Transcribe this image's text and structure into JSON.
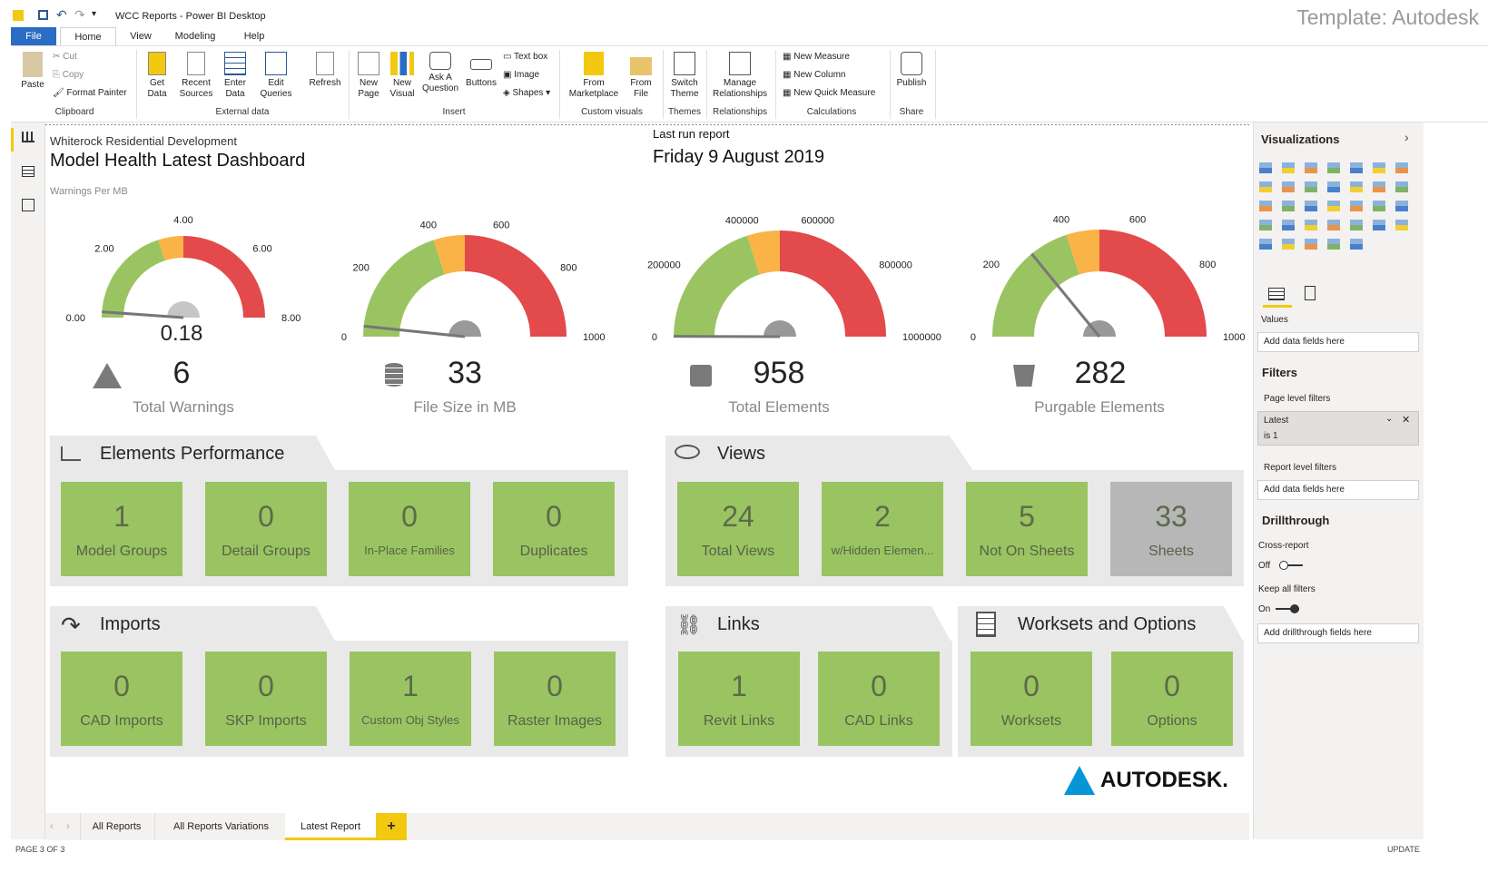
{
  "window": {
    "title": "WCC Reports - Power BI Desktop",
    "template_label": "Template: Autodesk"
  },
  "menu_tabs": [
    "File",
    "Home",
    "View",
    "Modeling",
    "Help"
  ],
  "ribbon": {
    "clipboard": {
      "paste": "Paste",
      "cut": "Cut",
      "copy": "Copy",
      "format_painter": "Format Painter",
      "group": "Clipboard"
    },
    "external": {
      "get_data": "Get Data",
      "recent_sources": "Recent Sources",
      "enter_data": "Enter Data",
      "edit_queries": "Edit Queries",
      "refresh": "Refresh",
      "group": "External data"
    },
    "insert": {
      "new_page": "New Page",
      "new_visual": "New Visual",
      "ask": "Ask A Question",
      "buttons": "Buttons",
      "text_box": "Text box",
      "image": "Image",
      "shapes": "Shapes",
      "group": "Insert"
    },
    "custom": {
      "marketplace": "From Marketplace",
      "file": "From File",
      "group": "Custom visuals"
    },
    "themes": {
      "switch": "Switch Theme",
      "group": "Themes"
    },
    "relationships": {
      "manage": "Manage Relationships",
      "group": "Relationships"
    },
    "calculations": {
      "new_measure": "New Measure",
      "new_column": "New Column",
      "new_quick": "New Quick Measure",
      "group": "Calculations"
    },
    "share": {
      "publish": "Publish",
      "group": "Share"
    }
  },
  "header": {
    "subtitle": "Whiterock Residential Development",
    "title": "Model Health Latest Dashboard",
    "last_run_label": "Last run report",
    "last_run_date": "Friday 9 August 2019",
    "gauge1_caption": "Warnings Per MB"
  },
  "gauges": [
    {
      "value_text": "0.18",
      "value": 0.18,
      "min": 0,
      "max": 8,
      "ticks": [
        "0.00",
        "2.00",
        "4.00",
        "6.00",
        "8.00"
      ]
    },
    {
      "value": 33,
      "min": 0,
      "max": 1000,
      "ticks": [
        "0",
        "200",
        "400",
        "600",
        "800",
        "1000"
      ]
    },
    {
      "value": 958,
      "min": 0,
      "max": 1000000,
      "ticks": [
        "0",
        "200000",
        "400000",
        "600000",
        "800000",
        "1000000"
      ]
    },
    {
      "value": 282,
      "min": 0,
      "max": 1000,
      "ticks": [
        "0",
        "200",
        "400",
        "600",
        "800",
        "1000"
      ]
    }
  ],
  "kpis": [
    {
      "value": "6",
      "label": "Total Warnings",
      "icon": "warning-icon"
    },
    {
      "value": "33",
      "label": "File Size in MB",
      "icon": "database-icon"
    },
    {
      "value": "958",
      "label": "Total Elements",
      "icon": "puzzle-icon"
    },
    {
      "value": "282",
      "label": "Purgable Elements",
      "icon": "recycle-bin-icon"
    }
  ],
  "sections": {
    "elements": {
      "title": "Elements Performance",
      "cards": [
        {
          "value": "1",
          "label": "Model Groups"
        },
        {
          "value": "0",
          "label": "Detail Groups"
        },
        {
          "value": "0",
          "label": "In-Place Families"
        },
        {
          "value": "0",
          "label": "Duplicates"
        }
      ]
    },
    "views": {
      "title": "Views",
      "cards": [
        {
          "value": "24",
          "label": "Total Views"
        },
        {
          "value": "2",
          "label": "w/Hidden Elemen..."
        },
        {
          "value": "5",
          "label": "Not On Sheets"
        },
        {
          "value": "33",
          "label": "Sheets"
        }
      ]
    },
    "imports": {
      "title": "Imports",
      "cards": [
        {
          "value": "0",
          "label": "CAD Imports"
        },
        {
          "value": "0",
          "label": "SKP Imports"
        },
        {
          "value": "1",
          "label": "Custom Obj Styles"
        },
        {
          "value": "0",
          "label": "Raster Images"
        }
      ]
    },
    "links": {
      "title": "Links",
      "cards": [
        {
          "value": "1",
          "label": "Revit Links"
        },
        {
          "value": "0",
          "label": "CAD Links"
        }
      ]
    },
    "worksets": {
      "title": "Worksets and Options",
      "cards": [
        {
          "value": "0",
          "label": "Worksets"
        },
        {
          "value": "0",
          "label": "Options"
        }
      ]
    }
  },
  "logo": "AUTODESK.",
  "pane": {
    "visualizations": "Visualizations",
    "values": "Values",
    "add_data": "Add data fields here",
    "filters": "Filters",
    "page_filters": "Page level filters",
    "filter_name": "Latest",
    "filter_cond": "is 1",
    "report_filters": "Report level filters",
    "add_data2": "Add data fields here",
    "drillthrough": "Drillthrough",
    "cross_report": "Cross-report",
    "off": "Off",
    "keep_filters": "Keep all filters",
    "on": "On",
    "add_drill": "Add drillthrough fields here"
  },
  "page_tabs": [
    "All Reports",
    "All Reports Variations",
    "Latest Report"
  ],
  "status": {
    "page": "PAGE 3 OF 3",
    "update": "UPDATE"
  },
  "colors": {
    "green": "#9ac461",
    "orange": "#f9b347",
    "red": "#e24a4b",
    "gray_card": "#b7b7b7",
    "accent": "#f2c811",
    "file_tab": "#2b6cc4"
  }
}
